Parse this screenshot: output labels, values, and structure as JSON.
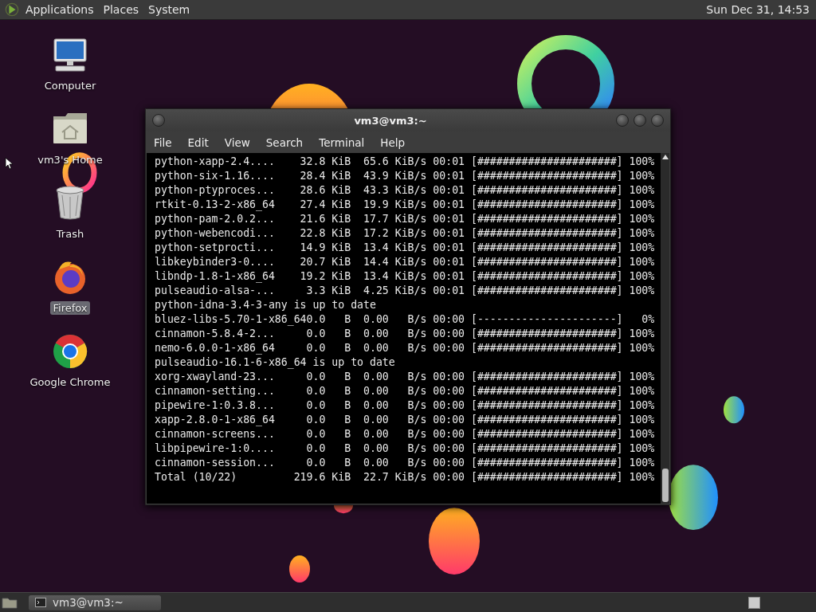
{
  "top_panel": {
    "menus": [
      "Applications",
      "Places",
      "System"
    ],
    "clock": "Sun Dec 31, 14:53"
  },
  "desktop_icons": [
    {
      "kind": "computer",
      "label": "Computer",
      "selected": false
    },
    {
      "kind": "home",
      "label": "vm3's Home",
      "selected": false
    },
    {
      "kind": "trash",
      "label": "Trash",
      "selected": false
    },
    {
      "kind": "firefox",
      "label": "Firefox",
      "selected": true
    },
    {
      "kind": "chrome",
      "label": "Google Chrome",
      "selected": false
    }
  ],
  "terminal": {
    "title": "vm3@vm3:~",
    "menu": [
      "File",
      "Edit",
      "View",
      "Search",
      "Terminal",
      "Help"
    ],
    "lines": [
      "python-xapp-2.4....    32.8 KiB  65.6 KiB/s 00:01 [######################] 100%",
      "python-six-1.16....    28.4 KiB  43.9 KiB/s 00:01 [######################] 100%",
      "python-ptyproces...    28.6 KiB  43.3 KiB/s 00:01 [######################] 100%",
      "rtkit-0.13-2-x86_64    27.4 KiB  19.9 KiB/s 00:01 [######################] 100%",
      "python-pam-2.0.2...    21.6 KiB  17.7 KiB/s 00:01 [######################] 100%",
      "python-webencodi...    22.8 KiB  17.2 KiB/s 00:01 [######################] 100%",
      "python-setprocti...    14.9 KiB  13.4 KiB/s 00:01 [######################] 100%",
      "libkeybinder3-0....    20.7 KiB  14.4 KiB/s 00:01 [######################] 100%",
      "libndp-1.8-1-x86_64    19.2 KiB  13.4 KiB/s 00:01 [######################] 100%",
      "pulseaudio-alsa-...     3.3 KiB  4.25 KiB/s 00:01 [######################] 100%",
      "python-idna-3.4-3-any is up to date",
      "bluez-libs-5.70-1-x86_640.0   B  0.00   B/s 00:00 [----------------------]   0%",
      "cinnamon-5.8.4-2...     0.0   B  0.00   B/s 00:00 [######################] 100%",
      "nemo-6.0.0-1-x86_64     0.0   B  0.00   B/s 00:00 [######################] 100%",
      "pulseaudio-16.1-6-x86_64 is up to date",
      "xorg-xwayland-23...     0.0   B  0.00   B/s 00:00 [######################] 100%",
      "cinnamon-setting...     0.0   B  0.00   B/s 00:00 [######################] 100%",
      "pipewire-1:0.3.8...     0.0   B  0.00   B/s 00:00 [######################] 100%",
      "xapp-2.8.0-1-x86_64     0.0   B  0.00   B/s 00:00 [######################] 100%",
      "cinnamon-screens...     0.0   B  0.00   B/s 00:00 [######################] 100%",
      "libpipewire-1:0....     0.0   B  0.00   B/s 00:00 [######################] 100%",
      "cinnamon-session...     0.0   B  0.00   B/s 00:00 [######################] 100%",
      "Total (10/22)         219.6 KiB  22.7 KiB/s 00:00 [######################] 100%"
    ]
  },
  "taskbar": {
    "tasks": [
      {
        "label": "vm3@vm3:~",
        "selected": true
      }
    ]
  }
}
